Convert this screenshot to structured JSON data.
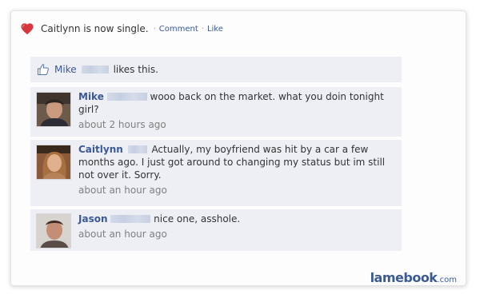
{
  "status": {
    "text": "Caitlynn is now single.",
    "separator": "·",
    "comment_label": "Comment",
    "like_label": "Like"
  },
  "likes": {
    "name": "Mike",
    "text": "likes this."
  },
  "comments": [
    {
      "author": "Mike",
      "text": "wooo back on the market. what you doin tonight girl?",
      "time": "about 2 hours ago"
    },
    {
      "author": "Caitlynn",
      "text": "Actually, my boyfriend was hit by a car a few months ago. I just got around to changing my status but im still not over it. Sorry.",
      "time": "about an hour ago"
    },
    {
      "author": "Jason",
      "text": "nice one, asshole.",
      "time": "about an hour ago"
    }
  ],
  "brand": {
    "main": "lamebook",
    "tld": ".com"
  },
  "icons": {
    "status_icon": "heart-icon",
    "likes_icon": "thumbs-up-icon"
  },
  "colors": {
    "link": "#3b5998",
    "comment_bg": "#edeff4",
    "heart": "#d8363f",
    "time_gray": "#808080"
  }
}
